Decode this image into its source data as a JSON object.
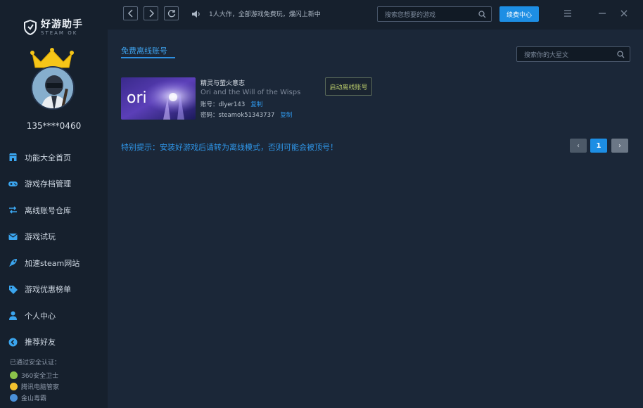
{
  "app": {
    "logo_main": "好游助手",
    "logo_sub": "STEAM OK"
  },
  "user": {
    "phone": "135****0460"
  },
  "sidebar": {
    "items": [
      {
        "label": "功能大全首页",
        "icon": "store-icon"
      },
      {
        "label": "游戏存档管理",
        "icon": "gamepad-icon"
      },
      {
        "label": "离线账号仓库",
        "icon": "swap-icon"
      },
      {
        "label": "游戏试玩",
        "icon": "mail-icon"
      },
      {
        "label": "加速steam网站",
        "icon": "rocket-icon"
      },
      {
        "label": "游戏优惠榜单",
        "icon": "tag-icon"
      },
      {
        "label": "个人中心",
        "icon": "user-icon"
      },
      {
        "label": "推荐好友",
        "icon": "share-icon"
      }
    ],
    "cert_title": "已通过安全认证：",
    "certs": [
      {
        "label": "360安全卫士",
        "color": "#8bc34a"
      },
      {
        "label": "腾讯电脑管家",
        "color": "#f2c12e"
      },
      {
        "label": "金山毒霸",
        "color": "#4a90d9"
      }
    ]
  },
  "topbar": {
    "notice": "1人大作，全部游戏免费玩，爆闪上新中",
    "search_placeholder": "搜索您想要的游戏",
    "recharge_label": "续费中心"
  },
  "main": {
    "tab_title": "免费离线账号",
    "search_placeholder": "搜索你的大星文",
    "game": {
      "image_text": "ori",
      "name_cn": "精灵与萤火意志",
      "name_en": "Ori and the Will of the Wisps",
      "account_label": "账号：",
      "account_value": "dlyer143",
      "password_label": "密码：",
      "password_value": "steamok51343737",
      "copy_label": "复制",
      "trial_button": "启动离线账号"
    },
    "tip": "特别提示：安装好游戏后请转为离线模式，否则可能会被顶号！",
    "pagination": {
      "prev": "‹",
      "current": "1",
      "next": "›"
    }
  }
}
